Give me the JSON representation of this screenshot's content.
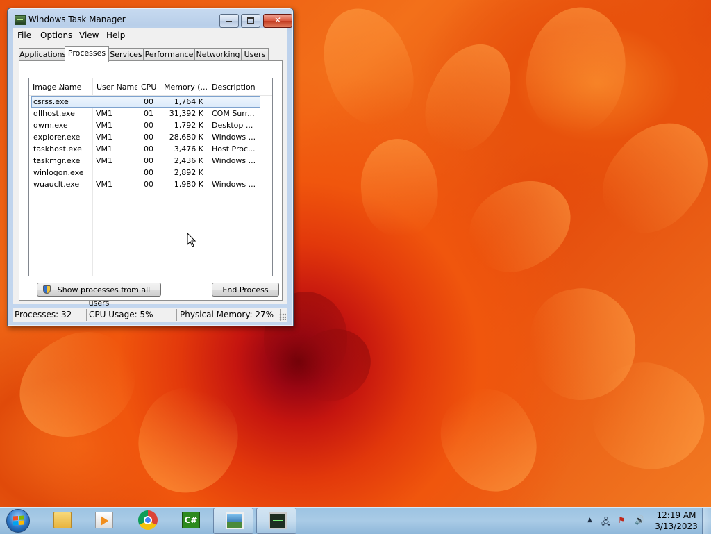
{
  "window": {
    "title": "Windows Task Manager",
    "close_glyph": "✕"
  },
  "menu": [
    "File",
    "Options",
    "View",
    "Help"
  ],
  "tabs": [
    {
      "label": "Applications",
      "active": false
    },
    {
      "label": "Processes",
      "active": true
    },
    {
      "label": "Services",
      "active": false
    },
    {
      "label": "Performance",
      "active": false
    },
    {
      "label": "Networking",
      "active": false
    },
    {
      "label": "Users",
      "active": false
    }
  ],
  "columns": [
    "Image Name",
    "User Name",
    "CPU",
    "Memory (...",
    "Description"
  ],
  "processes": [
    {
      "image": "csrss.exe",
      "user": "",
      "cpu": "00",
      "memory": "1,764 K",
      "description": "",
      "selected": true
    },
    {
      "image": "dllhost.exe",
      "user": "VM1",
      "cpu": "01",
      "memory": "31,392 K",
      "description": "COM Surr..."
    },
    {
      "image": "dwm.exe",
      "user": "VM1",
      "cpu": "00",
      "memory": "1,792 K",
      "description": "Desktop ..."
    },
    {
      "image": "explorer.exe",
      "user": "VM1",
      "cpu": "00",
      "memory": "28,680 K",
      "description": "Windows ..."
    },
    {
      "image": "taskhost.exe",
      "user": "VM1",
      "cpu": "00",
      "memory": "3,476 K",
      "description": "Host Proc..."
    },
    {
      "image": "taskmgr.exe",
      "user": "VM1",
      "cpu": "00",
      "memory": "2,436 K",
      "description": "Windows ..."
    },
    {
      "image": "winlogon.exe",
      "user": "",
      "cpu": "00",
      "memory": "2,892 K",
      "description": ""
    },
    {
      "image": "wuauclt.exe",
      "user": "VM1",
      "cpu": "00",
      "memory": "1,980 K",
      "description": "Windows ..."
    }
  ],
  "buttons": {
    "show_all": "Show processes from all users",
    "end_process": "End Process"
  },
  "status": {
    "processes": "Processes: 32",
    "cpu": "CPU Usage: 5%",
    "memory": "Physical Memory: 27%"
  },
  "taskbar": {
    "apps": [
      "folder-icon",
      "media-player-icon",
      "chrome-icon",
      "csharp-project-icon",
      "picture-viewer-icon",
      "task-manager-icon"
    ],
    "active_app": "task-manager-icon",
    "csharp_label": "C#"
  },
  "tray": {
    "time": "12:19 AM",
    "date": "3/13/2023"
  }
}
